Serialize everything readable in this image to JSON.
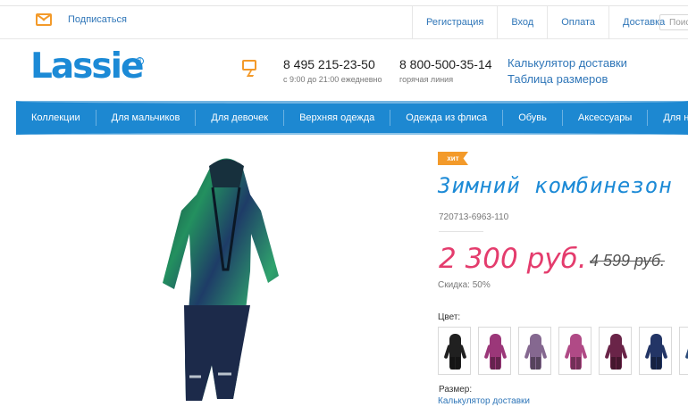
{
  "top_bar": {
    "subscribe": "Подписаться",
    "links": [
      "Регистрация",
      "Вход",
      "Оплата",
      "Доставка"
    ],
    "search_placeholder": "Поис"
  },
  "header": {
    "logo": "Lassie",
    "phone1": "8 495 215-23-50",
    "phone1_note": "с 9:00 до 21:00 ежедневно",
    "phone2": "8 800-500-35-14",
    "phone2_note": "горячая линия",
    "link1": "Калькулятор доставки",
    "link2": "Таблица размеров"
  },
  "nav": {
    "items": [
      "Коллекции",
      "Для мальчиков",
      "Для девочек",
      "Верхняя одежда",
      "Одежда из флиса",
      "Обувь",
      "Аксессуары",
      "Для ново"
    ]
  },
  "product": {
    "badge": "хит",
    "title": "Зимний комбинезон",
    "sku": "720713-6963-110",
    "price": "2 300 руб.",
    "old_price": "4 599 руб.",
    "discount": "Скидка: 50%",
    "color_label": "Цвет:",
    "swatches": [
      "#202020",
      "#9b3779",
      "#856890",
      "#b04a86",
      "#6a2448",
      "#233566",
      "#2a4a7a"
    ],
    "size_label": "Размер:",
    "delivery_link": "Калькулятор доставки"
  },
  "colors": {
    "brand_blue": "#1d88d1",
    "accent_orange": "#f39a2a",
    "price_pink": "#e43c6d"
  }
}
